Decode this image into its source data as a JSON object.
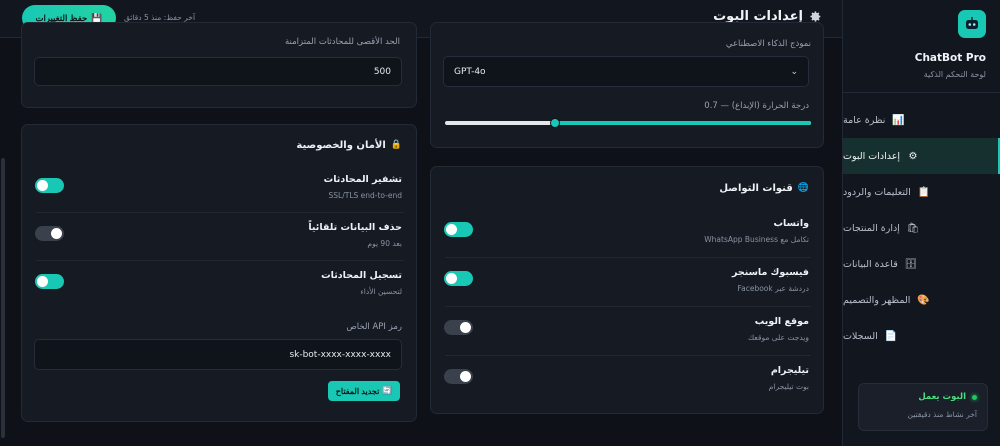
{
  "brand": {
    "name": "ChatBot Pro",
    "subtitle": "لوحة التحكم الذكية"
  },
  "nav": [
    {
      "label": "نظرة عامة",
      "icon": "chart-icon",
      "glyph": "📊",
      "active": false
    },
    {
      "label": "إعدادات البوت",
      "icon": "gear-icon",
      "glyph": "⚙",
      "active": true
    },
    {
      "label": "التعليمات والردود",
      "icon": "notes-icon",
      "glyph": "📋",
      "active": false
    },
    {
      "label": "إدارة المنتجات",
      "icon": "shopping-bags-icon",
      "glyph": "🛍",
      "active": false
    },
    {
      "label": "قاعدة البيانات",
      "icon": "database-icon",
      "glyph": "🗄",
      "active": false
    },
    {
      "label": "المظهر والتصميم",
      "icon": "palette-icon",
      "glyph": "🎨",
      "active": false
    },
    {
      "label": "السجلات",
      "icon": "log-icon",
      "glyph": "📄",
      "active": false
    }
  ],
  "status": {
    "title": "البوت يعمل",
    "subtitle": "آخر نشاط منذ دقيقتين"
  },
  "header": {
    "title": "إعدادات البوت",
    "save_label": "حفظ التغييرات",
    "last_saved": "آخر حفظ: منذ 5 دقائق"
  },
  "ai": {
    "model_label": "نموذج الذكاء الاصطناعي",
    "model_value": "GPT-4o",
    "temp_label": "درجة الحرارة (الإبداع) — 0.7",
    "temperature": 0.7
  },
  "limits": {
    "max_label": "الحد الأقصى للمحادثات المتزامنة",
    "max_value": "500"
  },
  "channels": {
    "title": "قنوات التواصل",
    "items": [
      {
        "title": "واتساب",
        "subtitle": "تكامل مع WhatsApp Business",
        "on": true
      },
      {
        "title": "فيسبوك ماسنجر",
        "subtitle": "دردشة عبر Facebook",
        "on": true
      },
      {
        "title": "موقع الويب",
        "subtitle": "ويدجت على موقعك",
        "on": false
      },
      {
        "title": "تيليجرام",
        "subtitle": "بوت تيليجرام",
        "on": false
      }
    ]
  },
  "security": {
    "title": "الأمان والخصوصية",
    "items": [
      {
        "title": "تشفير المحادثات",
        "subtitle": "SSL/TLS end-to-end",
        "on": true
      },
      {
        "title": "حذف البيانات تلقائياً",
        "subtitle": "بعد 90 يوم",
        "on": false
      },
      {
        "title": "تسجيل المحادثات",
        "subtitle": "لتحسين الأداء",
        "on": true
      }
    ],
    "api_label": "رمز API الخاص",
    "api_value": "sk-bot-xxxx-xxxx-xxxx",
    "regen_label": "تجديد المفتاح"
  },
  "colors": {
    "accent": "#19c8b4",
    "bg": "#0e1117",
    "card": "#151a23"
  }
}
